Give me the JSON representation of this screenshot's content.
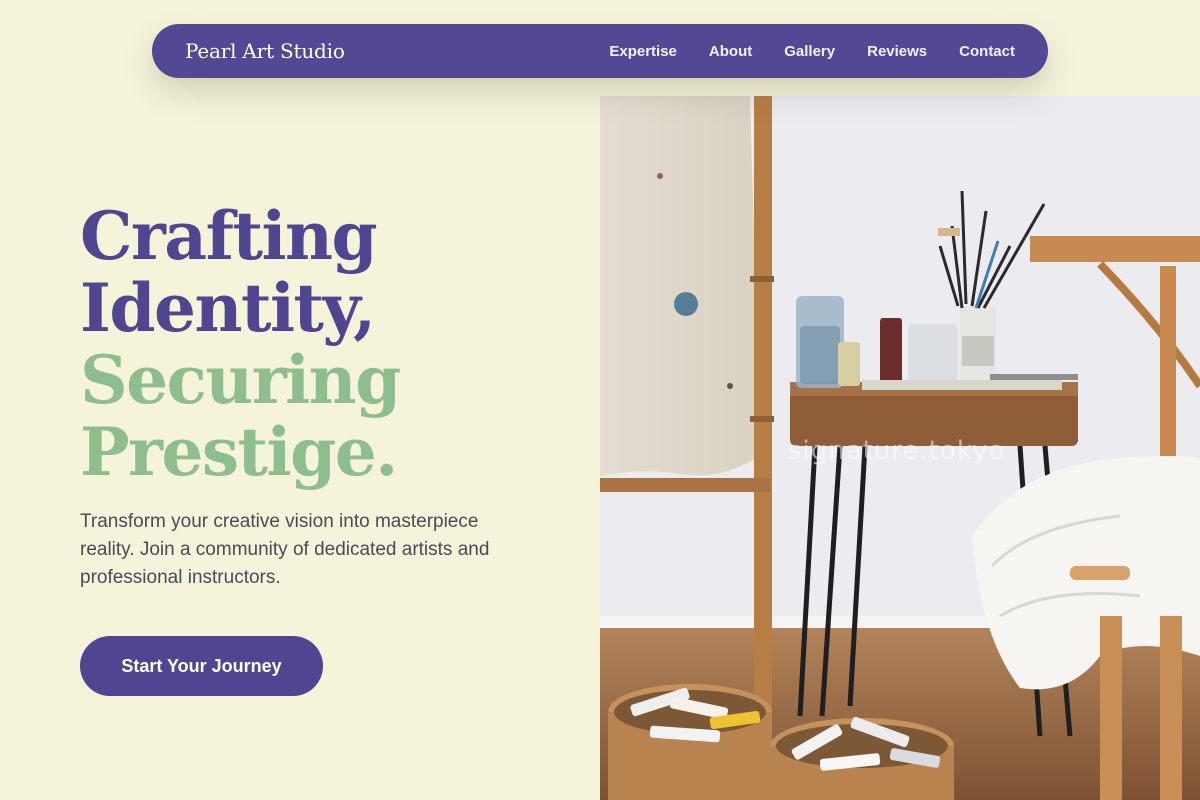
{
  "nav": {
    "brand": "Pearl Art Studio",
    "links": [
      "Expertise",
      "About",
      "Gallery",
      "Reviews",
      "Contact"
    ]
  },
  "hero": {
    "headline": [
      "Crafting",
      "Identity,",
      "Securing",
      "Prestige."
    ],
    "subtitle": "Transform your creative vision into masterpiece reality. Join a community of dedicated artists and professional instructors.",
    "cta_label": "Start Your Journey",
    "image_watermark": "signature.tokyo"
  },
  "colors": {
    "background": "#f5f4da",
    "primary": "#524893",
    "accent_green": "#8fbe8e",
    "body_text": "#4a4a58"
  }
}
